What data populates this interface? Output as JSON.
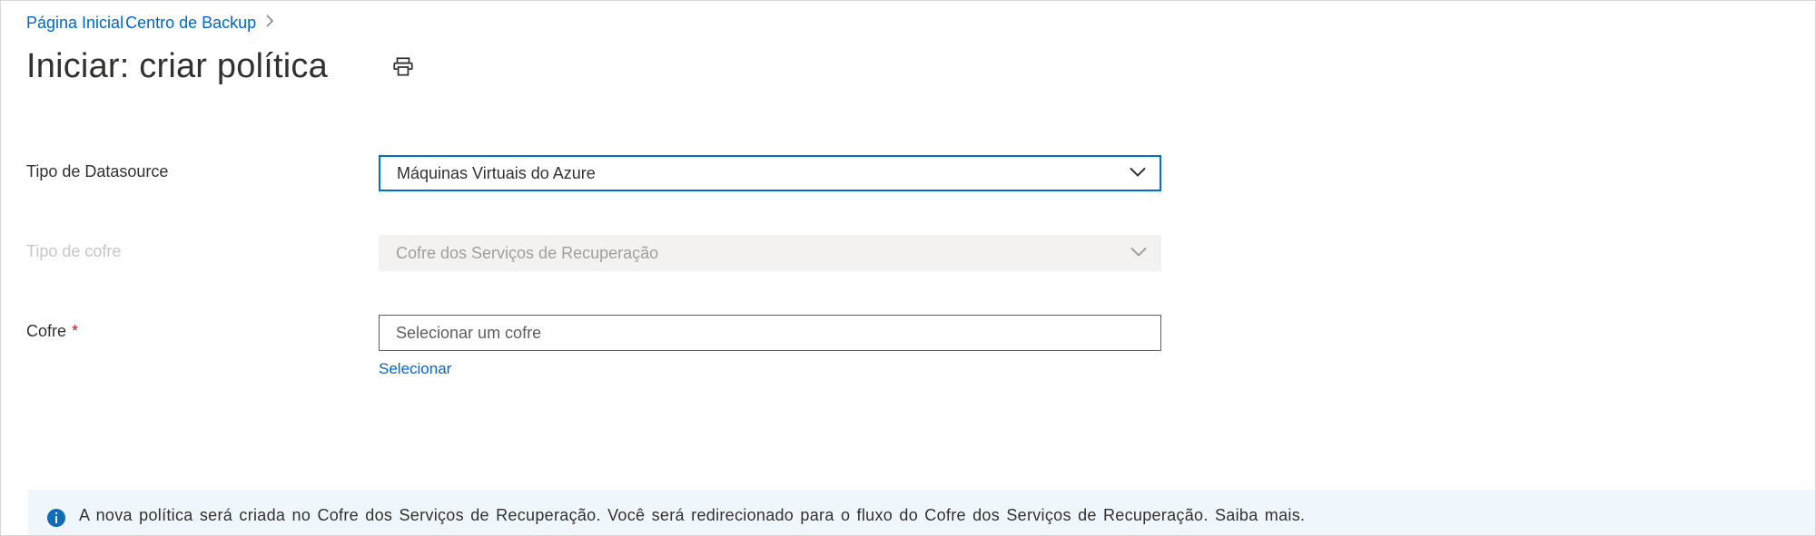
{
  "breadcrumb": {
    "home": "Página Inicial",
    "backup_center": "Centro de Backup"
  },
  "page_title": "Iniciar: criar política",
  "form": {
    "datasource_type": {
      "label": "Tipo de Datasource",
      "value": "Máquinas Virtuais do Azure"
    },
    "vault_type": {
      "label": "Tipo de cofre",
      "value": "Cofre dos Serviços de Recuperação"
    },
    "vault": {
      "label": "Cofre",
      "placeholder": "Selecionar um cofre",
      "select_link": "Selecionar"
    }
  },
  "info": {
    "text": "A nova política será criada no Cofre dos Serviços de Recuperação. Você será redirecionado para o fluxo do Cofre dos Serviços de Recuperação. ",
    "link": "Saiba mais."
  }
}
